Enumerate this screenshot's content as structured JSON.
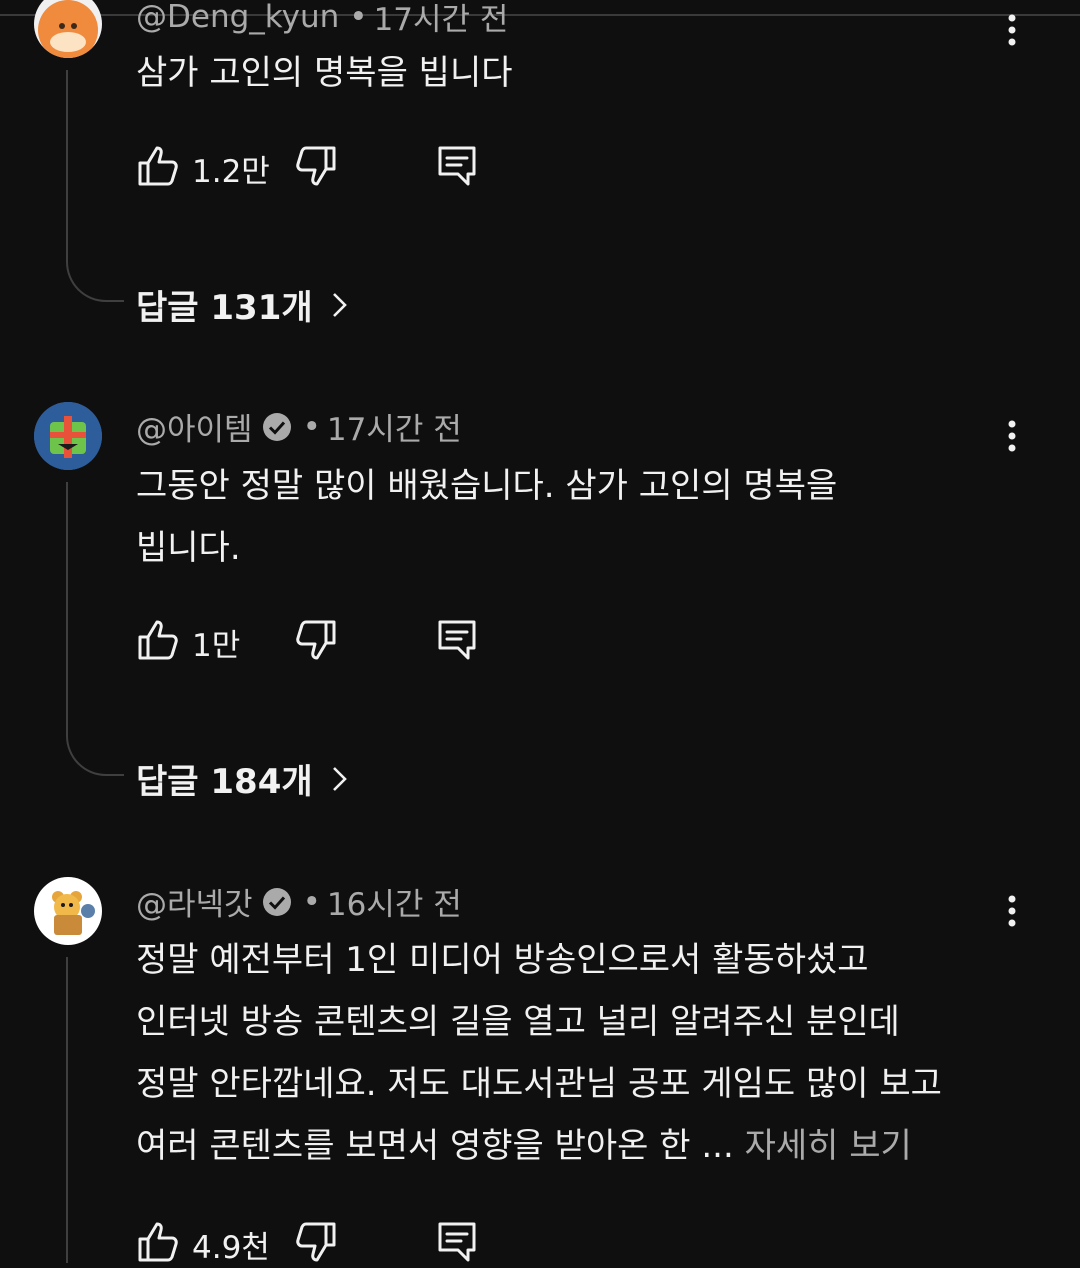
{
  "comments": [
    {
      "author": "@Deng_kyun",
      "time": "17시간 전",
      "lines": [
        "삼가 고인의 명복을 빕니다"
      ],
      "likes": "1.2만",
      "replies_label": "답글 131개"
    },
    {
      "author": "@아이템",
      "time": "17시간 전",
      "lines": [
        "그동안 정말 많이 배웠습니다. 삼가 고인의 명복을",
        "빕니다."
      ],
      "likes": "1만",
      "replies_label": "답글 184개"
    },
    {
      "author": "@라넥갓",
      "time": "16시간 전",
      "lines": [
        "정말 예전부터 1인 미디어 방송인으로서 활동하셨고",
        "인터넷 방송 콘텐츠의 길을 열고 널리 알려주신 분인데",
        "정말 안타깝네요. 저도 대도서관님 공포 게임도 많이 보고",
        "여러 콘텐츠를 보면서 영향을 받아온 한 ..."
      ],
      "more_label": "자세히 보기",
      "likes": "4.9천"
    }
  ],
  "separator": "•",
  "icons": {
    "like": "thumbs-up-icon",
    "dislike": "thumbs-down-icon",
    "reply": "reply-comment-icon",
    "menu": "more-vert-icon",
    "verified": "verified-check-icon",
    "expand": "chevron-right-icon"
  },
  "colors": {
    "background": "#0f0f0f",
    "text": "#f1f1f1",
    "secondary": "#aaaaaa",
    "thread_line": "#3f3f3f"
  }
}
